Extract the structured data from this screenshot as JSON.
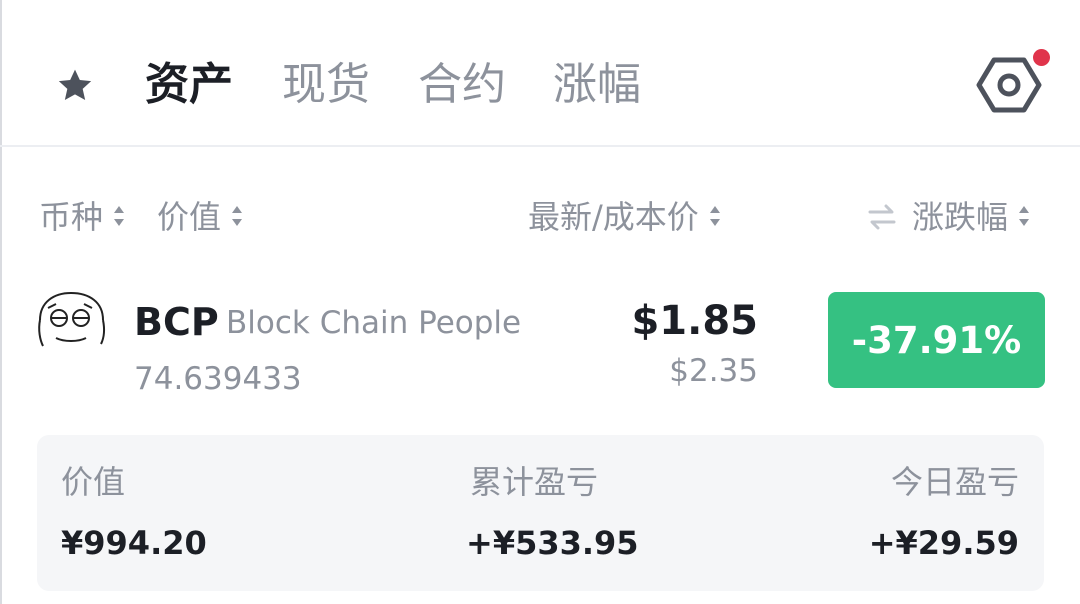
{
  "tabs": [
    {
      "label": "资产",
      "active": true
    },
    {
      "label": "现货",
      "active": false
    },
    {
      "label": "合约",
      "active": false
    },
    {
      "label": "涨幅",
      "active": false
    }
  ],
  "icons": {
    "favorites": "star-icon",
    "settings": "hexagon-settings-icon",
    "swap": "swap-arrows-icon",
    "sort": "sort-updown-icon",
    "coin": "meme-face-icon"
  },
  "colors": {
    "accent_green": "#35c182",
    "notification_dot": "#e0344b",
    "text_primary": "#1c1f26",
    "text_secondary": "#8d929c",
    "card_bg": "#f5f6f8"
  },
  "columns": {
    "coin": "币种",
    "value": "价值",
    "latest_cost": "最新/成本价",
    "change": "涨跌幅"
  },
  "asset": {
    "symbol": "BCP",
    "name": "Block Chain People",
    "amount": "74.639433",
    "price": "$1.85",
    "cost_price": "$2.35",
    "change_pct": "-37.91%"
  },
  "summary": {
    "value_label": "价值",
    "value": "¥994.20",
    "total_pnl_label": "累计盈亏",
    "total_pnl": "+¥533.95",
    "today_pnl_label": "今日盈亏",
    "today_pnl": "+¥29.59"
  }
}
